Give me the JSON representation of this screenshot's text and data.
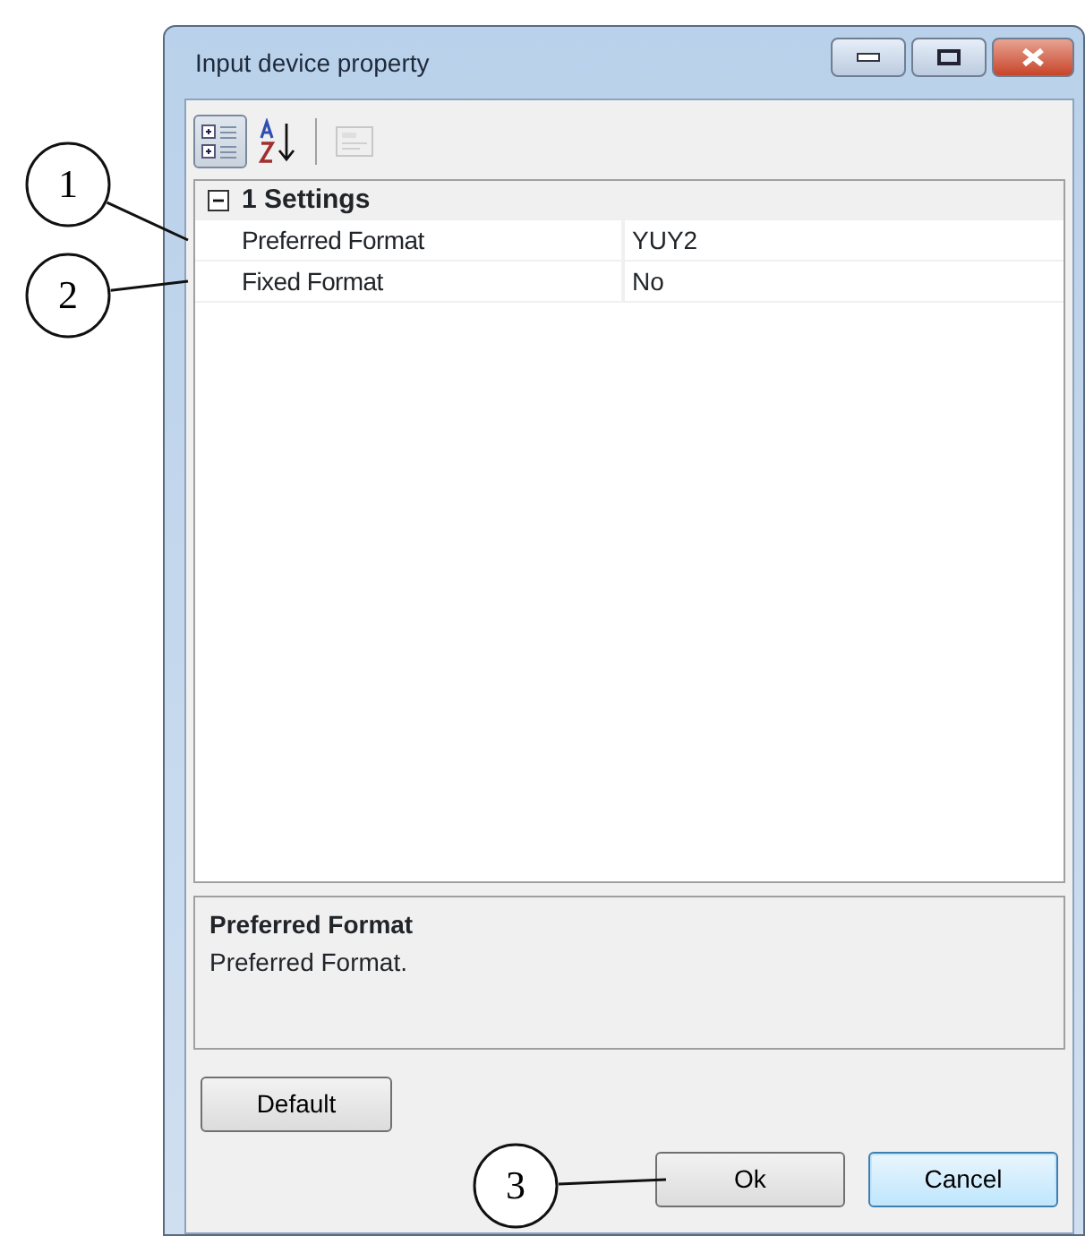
{
  "window": {
    "title": "Input device property"
  },
  "toolbar": [
    {
      "kind": "categorized",
      "selected": true,
      "disabled": false
    },
    {
      "kind": "alphabetical",
      "selected": false,
      "disabled": false
    },
    {
      "kind": "pages",
      "selected": false,
      "disabled": true
    }
  ],
  "grid": {
    "category": {
      "label": "1 Settings",
      "expanded": true
    },
    "rows": [
      {
        "name": "Preferred Format",
        "value": "YUY2"
      },
      {
        "name": "Fixed Format",
        "value": "No"
      }
    ]
  },
  "help": {
    "title": "Preferred Format",
    "text": "Preferred Format."
  },
  "buttons": [
    {
      "kind": "default",
      "label": "Default",
      "focused": false
    },
    {
      "kind": "ok",
      "label": "Ok",
      "focused": false
    },
    {
      "kind": "cancel",
      "label": "Cancel",
      "focused": true
    }
  ],
  "callouts": [
    {
      "label": "1"
    },
    {
      "label": "2"
    },
    {
      "label": "3"
    }
  ]
}
